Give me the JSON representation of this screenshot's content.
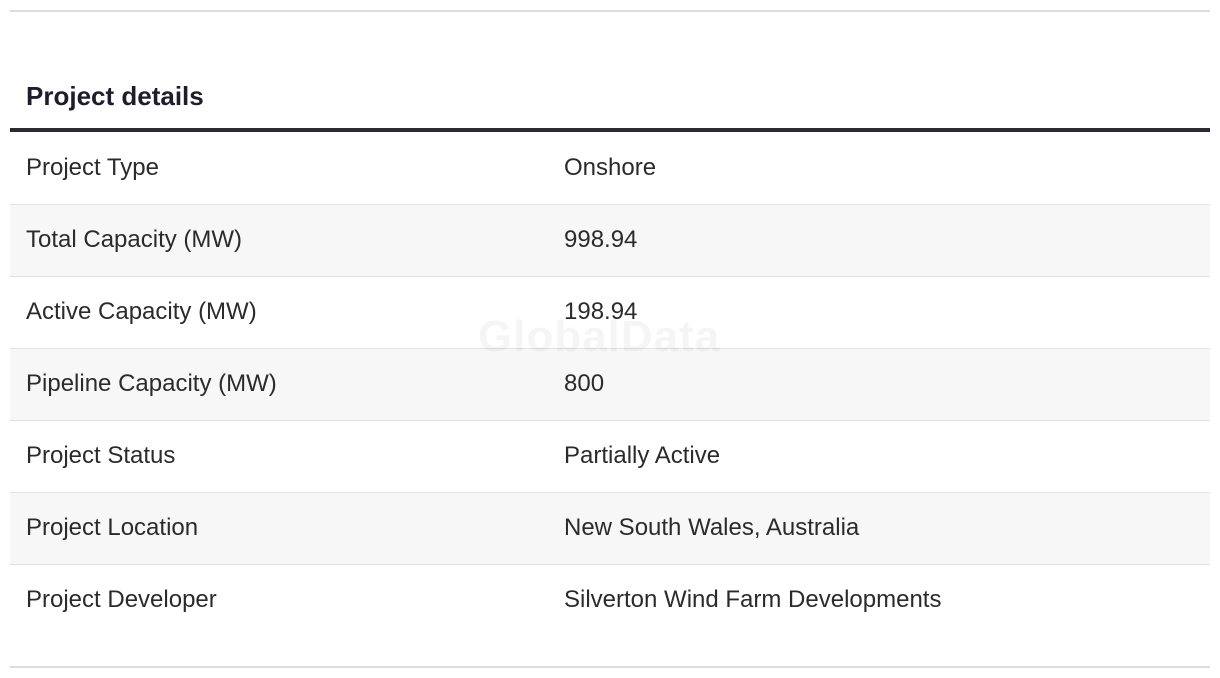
{
  "section": {
    "title": "Project details"
  },
  "watermark": "GlobalData",
  "rows": [
    {
      "label": "Project Type",
      "value": "Onshore"
    },
    {
      "label": "Total Capacity (MW)",
      "value": "998.94"
    },
    {
      "label": "Active Capacity (MW)",
      "value": "198.94"
    },
    {
      "label": "Pipeline Capacity (MW)",
      "value": "800"
    },
    {
      "label": "Project Status",
      "value": "Partially Active"
    },
    {
      "label": "Project Location",
      "value": "New South Wales, Australia"
    },
    {
      "label": "Project Developer",
      "value": "Silverton Wind Farm Developments"
    }
  ]
}
